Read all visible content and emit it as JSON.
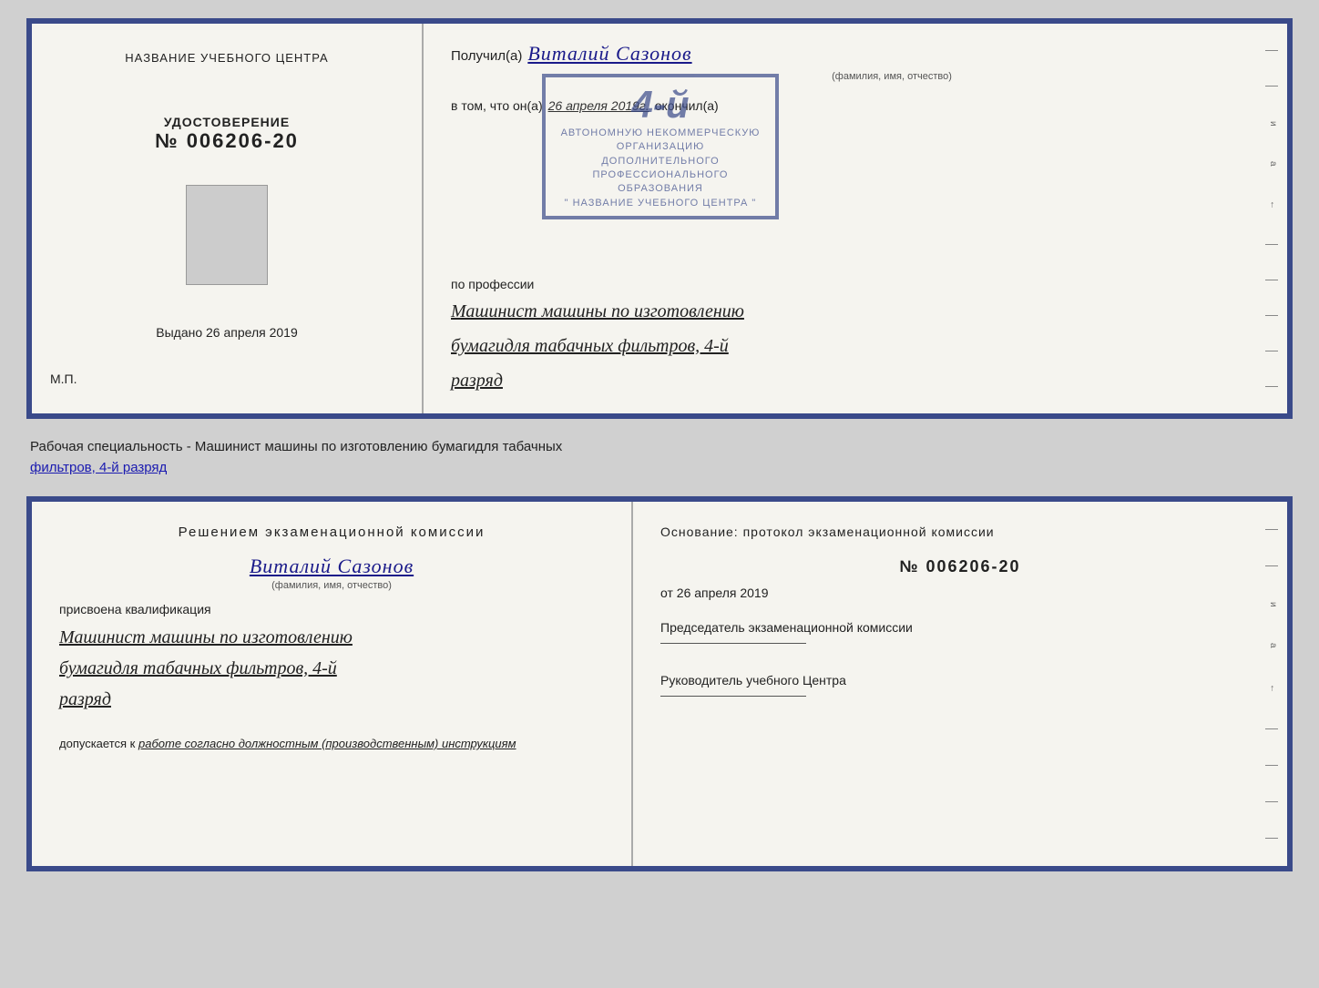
{
  "top_cert": {
    "left": {
      "training_center_label": "НАЗВАНИЕ УЧЕБНОГО ЦЕНТРА",
      "udostoverenie_label": "УДОСТОВЕРЕНИЕ",
      "cert_number": "№ 006206-20",
      "vydano_label": "Выдано",
      "vydano_date": "26 апреля 2019",
      "mp_label": "М.П."
    },
    "right": {
      "poluchil_prefix": "Получил(а)",
      "recipient_name": "Виталий Сазонов",
      "fio_label": "(фамилия, имя, отчество)",
      "vtom_prefix": "в том, что он(а)",
      "vtom_date": "26 апреля 2019г.",
      "okonchil_label": "окончил(а)",
      "stamp_number": "4-й",
      "stamp_line1": "АВТОНОМНУЮ НЕКОММЕРЧЕСКУЮ ОРГАНИЗАЦИЮ",
      "stamp_line2": "ДОПОЛНИТЕЛЬНОГО ПРОФЕССИОНАЛЬНОГО ОБРАЗОВАНИЯ",
      "stamp_line3": "\" НАЗВАНИЕ УЧЕБНОГО ЦЕНТРА \"",
      "po_professii_label": "по профессии",
      "profession_line1": "Машинист машины по изготовлению",
      "profession_line2": "бумагидля табачных фильтров, 4-й",
      "profession_line3": "разряд"
    }
  },
  "middle": {
    "text_prefix": "Рабочая специальность - Машинист машины по изготовлению бумагидля табачных",
    "text_underline": "фильтров, 4-й разряд"
  },
  "bottom_cert": {
    "left": {
      "resheniem_title": "Решением  экзаменационной  комиссии",
      "name_handwritten": "Виталий Сазонов",
      "fio_label": "(фамилия, имя, отчество)",
      "prisvoena_label": "присвоена квалификация",
      "kvalf_line1": "Машинист машины по изготовлению",
      "kvalf_line2": "бумагидля табачных фильтров, 4-й",
      "kvalf_line3": "разряд",
      "dopuskaetsya_prefix": "допускается к",
      "dopuskaetsya_text": "работе согласно должностным (производственным) инструкциям"
    },
    "right": {
      "osnovanie_label": "Основание: протокол экзаменационной  комиссии",
      "protocol_number": "№  006206-20",
      "ot_prefix": "от",
      "ot_date": "26 апреля 2019",
      "predsedatel_label": "Председатель экзаменационной комиссии",
      "rukovoditel_label": "Руководитель учебного Центра"
    }
  }
}
